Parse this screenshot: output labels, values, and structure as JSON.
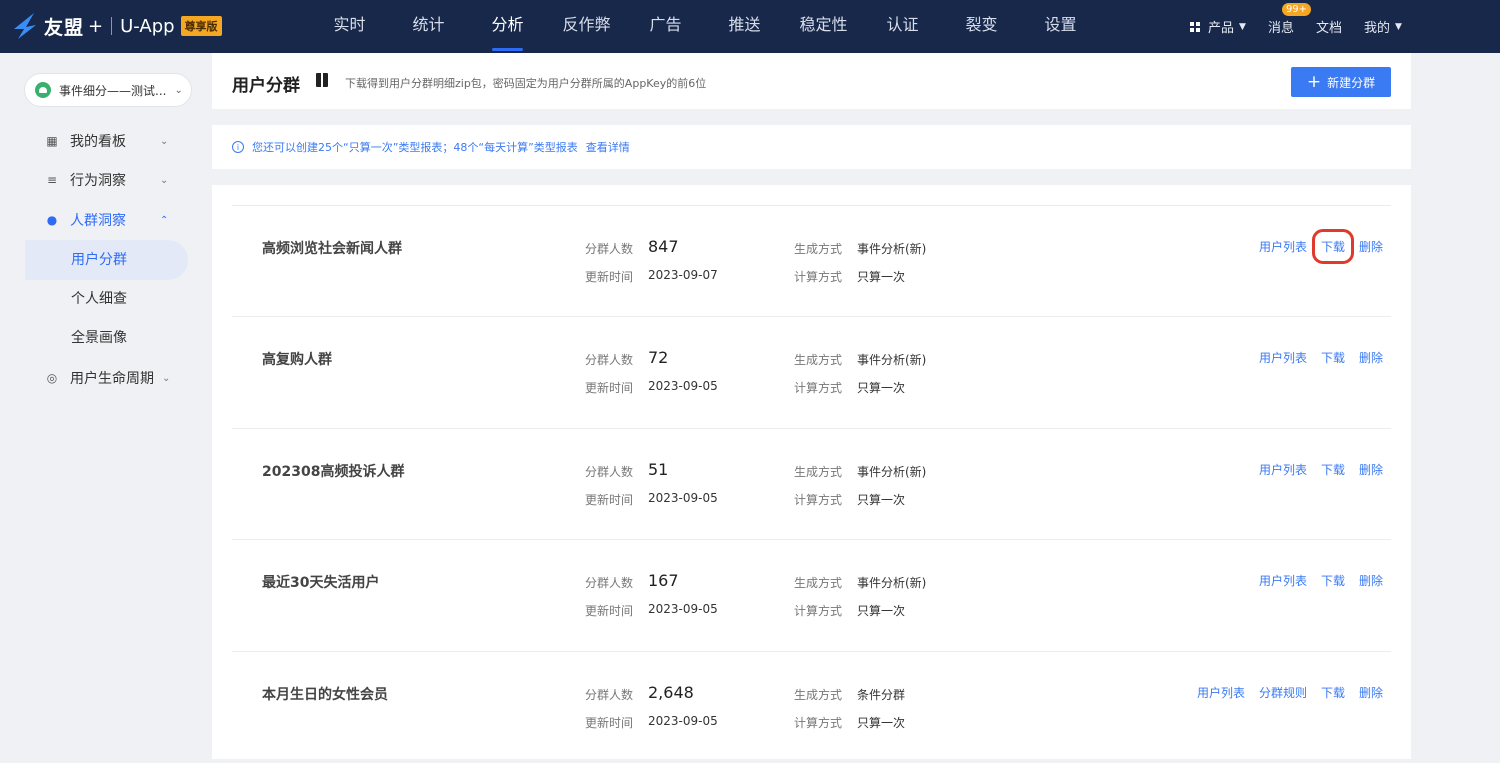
{
  "topnav": {
    "brand": "友盟",
    "plus": "+",
    "app": "U-App",
    "tier": "尊享版",
    "menu": [
      "实时",
      "统计",
      "分析",
      "反作弊",
      "广告",
      "推送",
      "稳定性",
      "认证",
      "裂变",
      "设置"
    ],
    "active_menu": "分析",
    "right": {
      "product": "产品",
      "message": "消息",
      "message_badge": "99+",
      "docs": "文档",
      "mine": "我的"
    }
  },
  "sidebar": {
    "app_selector": "事件细分——测试...",
    "items": [
      {
        "label": "我的看板",
        "icon": "chart-icon"
      },
      {
        "label": "行为洞察",
        "icon": "behavior-icon"
      },
      {
        "label": "人群洞察",
        "icon": "user-group-icon"
      },
      {
        "label": "用户生命周期",
        "icon": "lifecycle-icon"
      }
    ],
    "subitems": [
      "用户分群",
      "个人细查",
      "全景画像"
    ]
  },
  "header": {
    "title": "用户分群",
    "desc": "下载得到用户分群明细zip包，密码固定为用户分群所属的AppKey的前6位",
    "new_button": "新建分群"
  },
  "notice": {
    "text": "您还可以创建25个“只算一次”类型报表；48个“每天计算”类型报表",
    "link": "查看详情"
  },
  "labels": {
    "count": "分群人数",
    "updated": "更新时间",
    "method": "生成方式",
    "calc": "计算方式"
  },
  "segments": [
    {
      "name": "高频浏览社会新闻人群",
      "count": "847",
      "updated": "2023-09-07",
      "method": "事件分析(新)",
      "calc": "只算一次",
      "actions": [
        "用户列表",
        "下载",
        "删除"
      ]
    },
    {
      "name": "高复购人群",
      "count": "72",
      "updated": "2023-09-05",
      "method": "事件分析(新)",
      "calc": "只算一次",
      "actions": [
        "用户列表",
        "下载",
        "删除"
      ]
    },
    {
      "name": "202308高频投诉人群",
      "count": "51",
      "updated": "2023-09-05",
      "method": "事件分析(新)",
      "calc": "只算一次",
      "actions": [
        "用户列表",
        "下载",
        "删除"
      ]
    },
    {
      "name": "最近30天失活用户",
      "count": "167",
      "updated": "2023-09-05",
      "method": "事件分析(新)",
      "calc": "只算一次",
      "actions": [
        "用户列表",
        "下载",
        "删除"
      ]
    },
    {
      "name": "本月生日的女性会员",
      "count": "2,648",
      "updated": "2023-09-05",
      "method": "条件分群",
      "calc": "只算一次",
      "actions": [
        "用户列表",
        "分群规则",
        "下载",
        "删除"
      ]
    }
  ],
  "colors": {
    "nav_bg": "#17284a",
    "accent": "#3a7af3",
    "highlight": "#e03a2e"
  }
}
